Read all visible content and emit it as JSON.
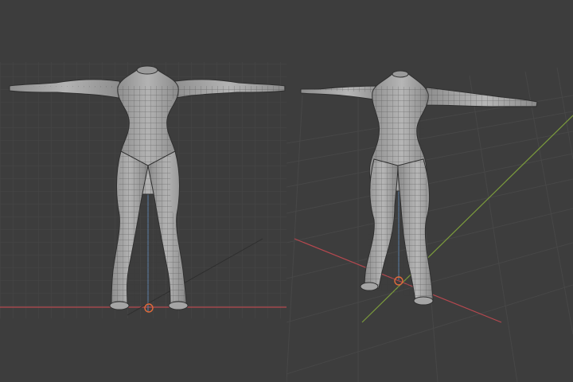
{
  "scene": {
    "background_color": "#3d3d3d",
    "grid_color": "#4a4a4a",
    "grid_major_color": "#525252",
    "axis_x_color": "#b5484f",
    "axis_y_color": "#7b9b3c",
    "axis_z_color": "#5d7fa6",
    "mesh_fill_color": "#a9a9a9",
    "mesh_shade_color": "#7f7f7f",
    "wire_color": "#2f2f2f",
    "origin_marker_color": "#e06b3b"
  },
  "viewports": [
    {
      "name": "front-orthographic-view",
      "projection": "orthographic",
      "model": "female-base-mesh",
      "pose": "t-pose"
    },
    {
      "name": "perspective-view",
      "projection": "perspective",
      "model": "female-base-mesh",
      "pose": "t-pose"
    }
  ]
}
